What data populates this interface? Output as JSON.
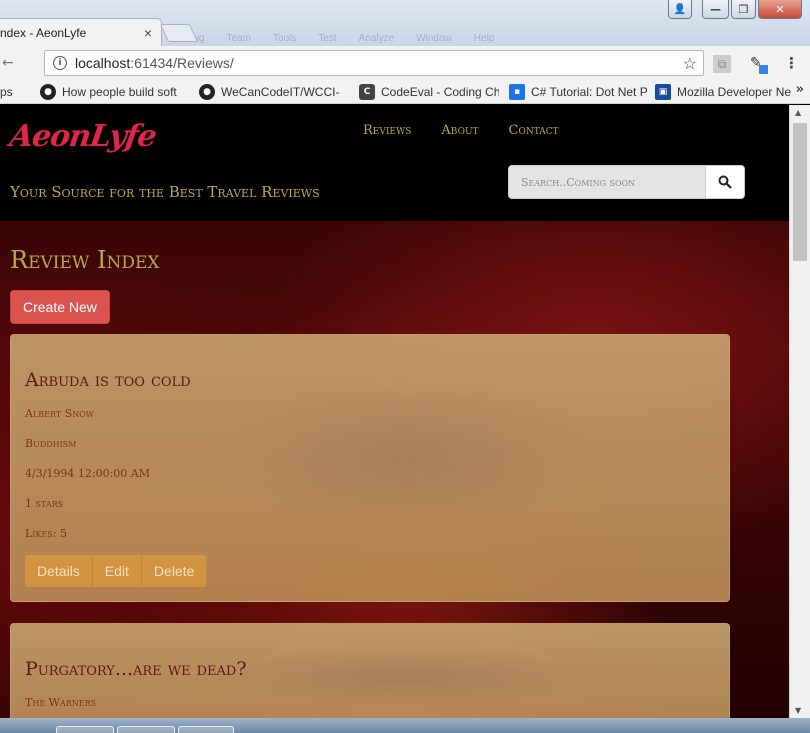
{
  "browser": {
    "ghost_menu": [
      "Debug",
      "Team",
      "Tools",
      "Test",
      "Analyze",
      "Window",
      "Help"
    ],
    "tab_title": "ndex - AeonLyfe",
    "tab_close": "×",
    "window_buttons": {
      "user": "👤",
      "minimize": "—",
      "maximize": "❐",
      "close": "✕"
    },
    "back_arrow": "←",
    "url_host": "localhost",
    "url_rest": ":61434/Reviews/",
    "menu_dots": "⋮",
    "bookmarks": [
      {
        "label": "ps",
        "icon": "",
        "color": "#f2f2f2"
      },
      {
        "label": "How people build soft",
        "icon": "github-icon",
        "color": "#222222"
      },
      {
        "label": "WeCanCodeIT/WCCI-",
        "icon": "github-icon",
        "color": "#222222"
      },
      {
        "label": "CodeEval - Coding Ch",
        "icon": "codeeval-icon",
        "color": "#444444"
      },
      {
        "label": "C# Tutorial: Dot Net P",
        "icon": "dotnet-icon",
        "color": "#1a73e8"
      },
      {
        "label": "Mozilla Developer Ne",
        "icon": "mdn-icon",
        "color": "#1a4b9c"
      }
    ],
    "bookmarks_more": "»"
  },
  "site": {
    "logo": "AeonLyfe",
    "nav": [
      "Reviews",
      "About",
      "Contact"
    ],
    "tagline": "Your Source for the Best Travel Reviews",
    "search_placeholder": "Search..Coming soon"
  },
  "main": {
    "title": "Review Index",
    "create_button": "Create New",
    "reviews": [
      {
        "title": "Arbuda is too cold",
        "author": "Albert Snow",
        "category": "Buddhism",
        "date": "4/3/1994 12:00:00 AM",
        "stars": "1 stars",
        "likes": "Likes: 5",
        "actions": [
          "Details",
          "Edit",
          "Delete"
        ]
      },
      {
        "title": "Purgatory...are we dead?",
        "author": "The Warners"
      }
    ]
  },
  "colors": {
    "accent_gold": "#b9a84a",
    "logo_red": "#e0244a",
    "create_red": "#d9534f",
    "card_tan": "#c4a06e"
  }
}
